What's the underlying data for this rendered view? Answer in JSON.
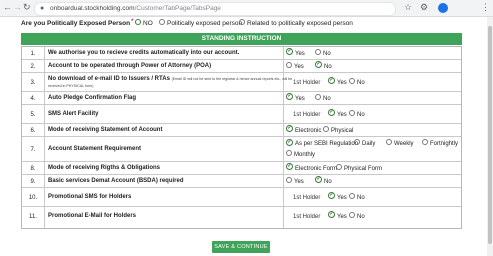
{
  "browser": {
    "url_host": "onboardual.stockholding.com",
    "url_path": "/CustomerTabPage/TabsPage",
    "back": "←",
    "forward": "→",
    "reload": "↻",
    "star": "☆",
    "extension": "⚙",
    "menu": "⋮"
  },
  "pep": {
    "question": "Are you Politically Exposed Person",
    "required_mark": "*",
    "options": [
      {
        "label": "NO",
        "selected": true
      },
      {
        "label": "Politically exposed person",
        "selected": false
      },
      {
        "label": "Related to politically exposed person",
        "selected": false
      }
    ]
  },
  "section_title": "STANDING INSTRUCTION",
  "rows": [
    {
      "num": "1.",
      "label": "We authorise you to recieve credits automatically into our account.",
      "options": [
        {
          "label": "Yes",
          "selected": true
        },
        {
          "label": "No",
          "selected": false
        }
      ]
    },
    {
      "num": "2.",
      "label": "Account to be operated through Power of Attorney (POA)",
      "options": [
        {
          "label": "Yes",
          "selected": false
        },
        {
          "label": "No",
          "selected": true
        }
      ]
    },
    {
      "num": "3.",
      "label": "No download of e-mail ID to Issuers / RTAs",
      "note": "(Email ID will not be sent to the registrar & hence annual reports etc., will be received in PHYSICAL form)",
      "holder": "1st Holder",
      "options": [
        {
          "label": "Yes",
          "selected": true
        },
        {
          "label": "No",
          "selected": false
        }
      ]
    },
    {
      "num": "4.",
      "label": "Auto Pledge Confirmation Flag",
      "options": [
        {
          "label": "Yes",
          "selected": true
        },
        {
          "label": "No",
          "selected": false
        }
      ]
    },
    {
      "num": "5.",
      "label": "SMS Alert Facility",
      "holder": "1st Holder",
      "options": [
        {
          "label": "Yes",
          "selected": true
        },
        {
          "label": "No",
          "selected": false
        }
      ]
    },
    {
      "num": "6.",
      "label": "Mode of receiving Statement of Account",
      "options": [
        {
          "label": "Electronic",
          "selected": true
        },
        {
          "label": "Physical",
          "selected": false
        }
      ]
    },
    {
      "num": "7.",
      "label": "Account Statement Requirement",
      "options": [
        {
          "label": "As per SEBI Regulation",
          "selected": true
        },
        {
          "label": "Daily",
          "selected": false
        },
        {
          "label": "Weekly",
          "selected": false
        },
        {
          "label": "Fortnightly",
          "selected": false
        },
        {
          "label": "Monthly",
          "selected": false
        }
      ]
    },
    {
      "num": "8.",
      "label": "Mode of receiving Rigths & Obligations",
      "options": [
        {
          "label": "Electronic Form",
          "selected": true
        },
        {
          "label": "Physical Form",
          "selected": false
        }
      ]
    },
    {
      "num": "9.",
      "label": "Basic services Demat Account (BSDA) required",
      "options": [
        {
          "label": "Yes",
          "selected": false
        },
        {
          "label": "No",
          "selected": true
        }
      ]
    },
    {
      "num": "10.",
      "label": "Promotional SMS for Holders",
      "holder": "1st Holder",
      "options": [
        {
          "label": "Yes",
          "selected": true
        },
        {
          "label": "No",
          "selected": false
        }
      ]
    },
    {
      "num": "11.",
      "label": "Promotional E-Mail for Holders",
      "holder": "1st Holder",
      "options": [
        {
          "label": "Yes",
          "selected": true
        },
        {
          "label": "No",
          "selected": false
        }
      ]
    }
  ],
  "save_button": "SAVE & CONTINUE",
  "colors": {
    "accent": "#3fa35a",
    "check": "#2d6d2d"
  }
}
